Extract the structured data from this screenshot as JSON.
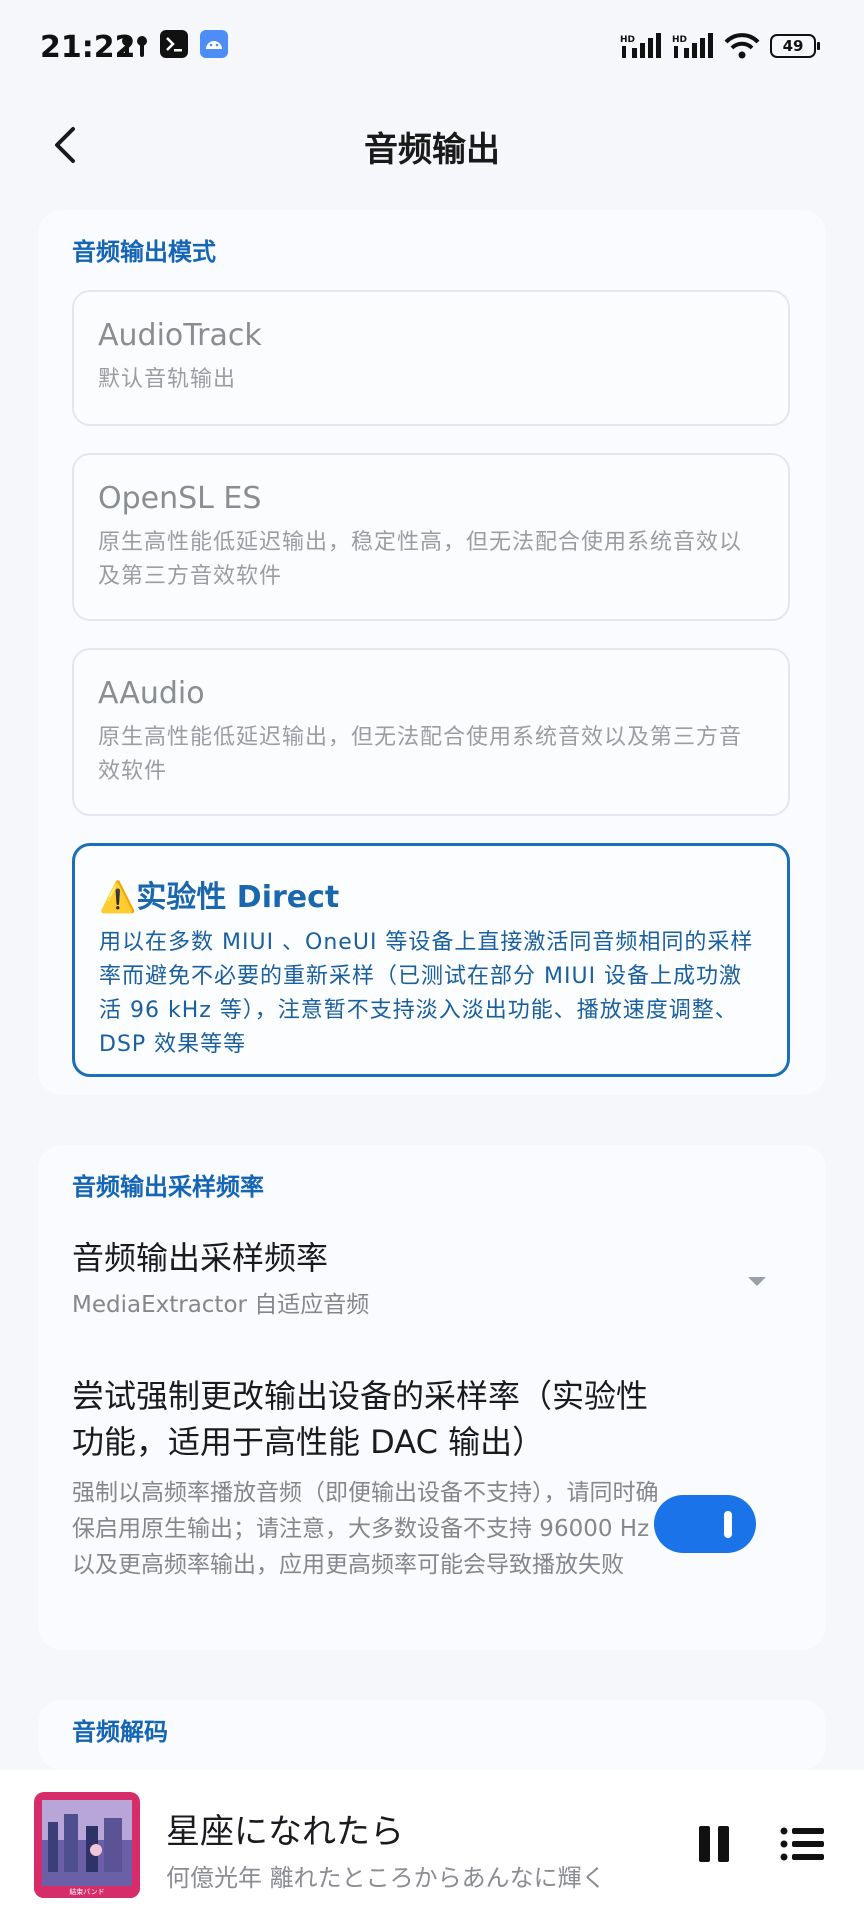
{
  "status_bar": {
    "time": "21:22",
    "battery": "49"
  },
  "header": {
    "title": "音频输出"
  },
  "output_mode": {
    "label": "音频输出模式",
    "options": [
      {
        "title": "AudioTrack",
        "desc": "默认音轨输出"
      },
      {
        "title": "OpenSL ES",
        "desc": "原生高性能低延迟输出，稳定性高，但无法配合使用系统音效以及第三方音效软件"
      },
      {
        "title": "AAudio",
        "desc": "原生高性能低延迟输出，但无法配合使用系统音效以及第三方音效软件"
      },
      {
        "title": "⚠️实验性 Direct",
        "desc": "用以在多数 MIUI 、OneUI 等设备上直接激活同音频相同的采样率而避免不必要的重新采样（已测试在部分 MIUI 设备上成功激活 96 kHz 等），注意暂不支持淡入淡出功能、播放速度调整、DSP 效果等等",
        "selected": true
      }
    ]
  },
  "sample_rate": {
    "label": "音频输出采样频率",
    "rate_title": "音频输出采样频率",
    "rate_value": "MediaExtractor 自适应音频",
    "force_title": "尝试强制更改输出设备的采样率（实验性功能，适用于高性能 DAC 输出）",
    "force_desc": "强制以高频率播放音频（即便输出设备不支持），请同时确保启用原生输出；请注意，大多数设备不支持 96000 Hz 以及更高频率输出，应用更高频率可能会导致播放失败",
    "force_enabled": true
  },
  "decode": {
    "label": "音频解码"
  },
  "player": {
    "song_title": "星座になれたら",
    "artist_line": "何億光年 離れたところからあんなに輝く",
    "art_caption": "結束バンド"
  },
  "colors": {
    "accent": "#1565b5",
    "toggle_on": "#1a73e8",
    "page_bg": "#f5f7fb"
  },
  "icons": {
    "back": "back-arrow-icon",
    "dropdown": "dropdown-triangle-icon",
    "pause": "pause-icon",
    "queue": "playlist-icon"
  }
}
